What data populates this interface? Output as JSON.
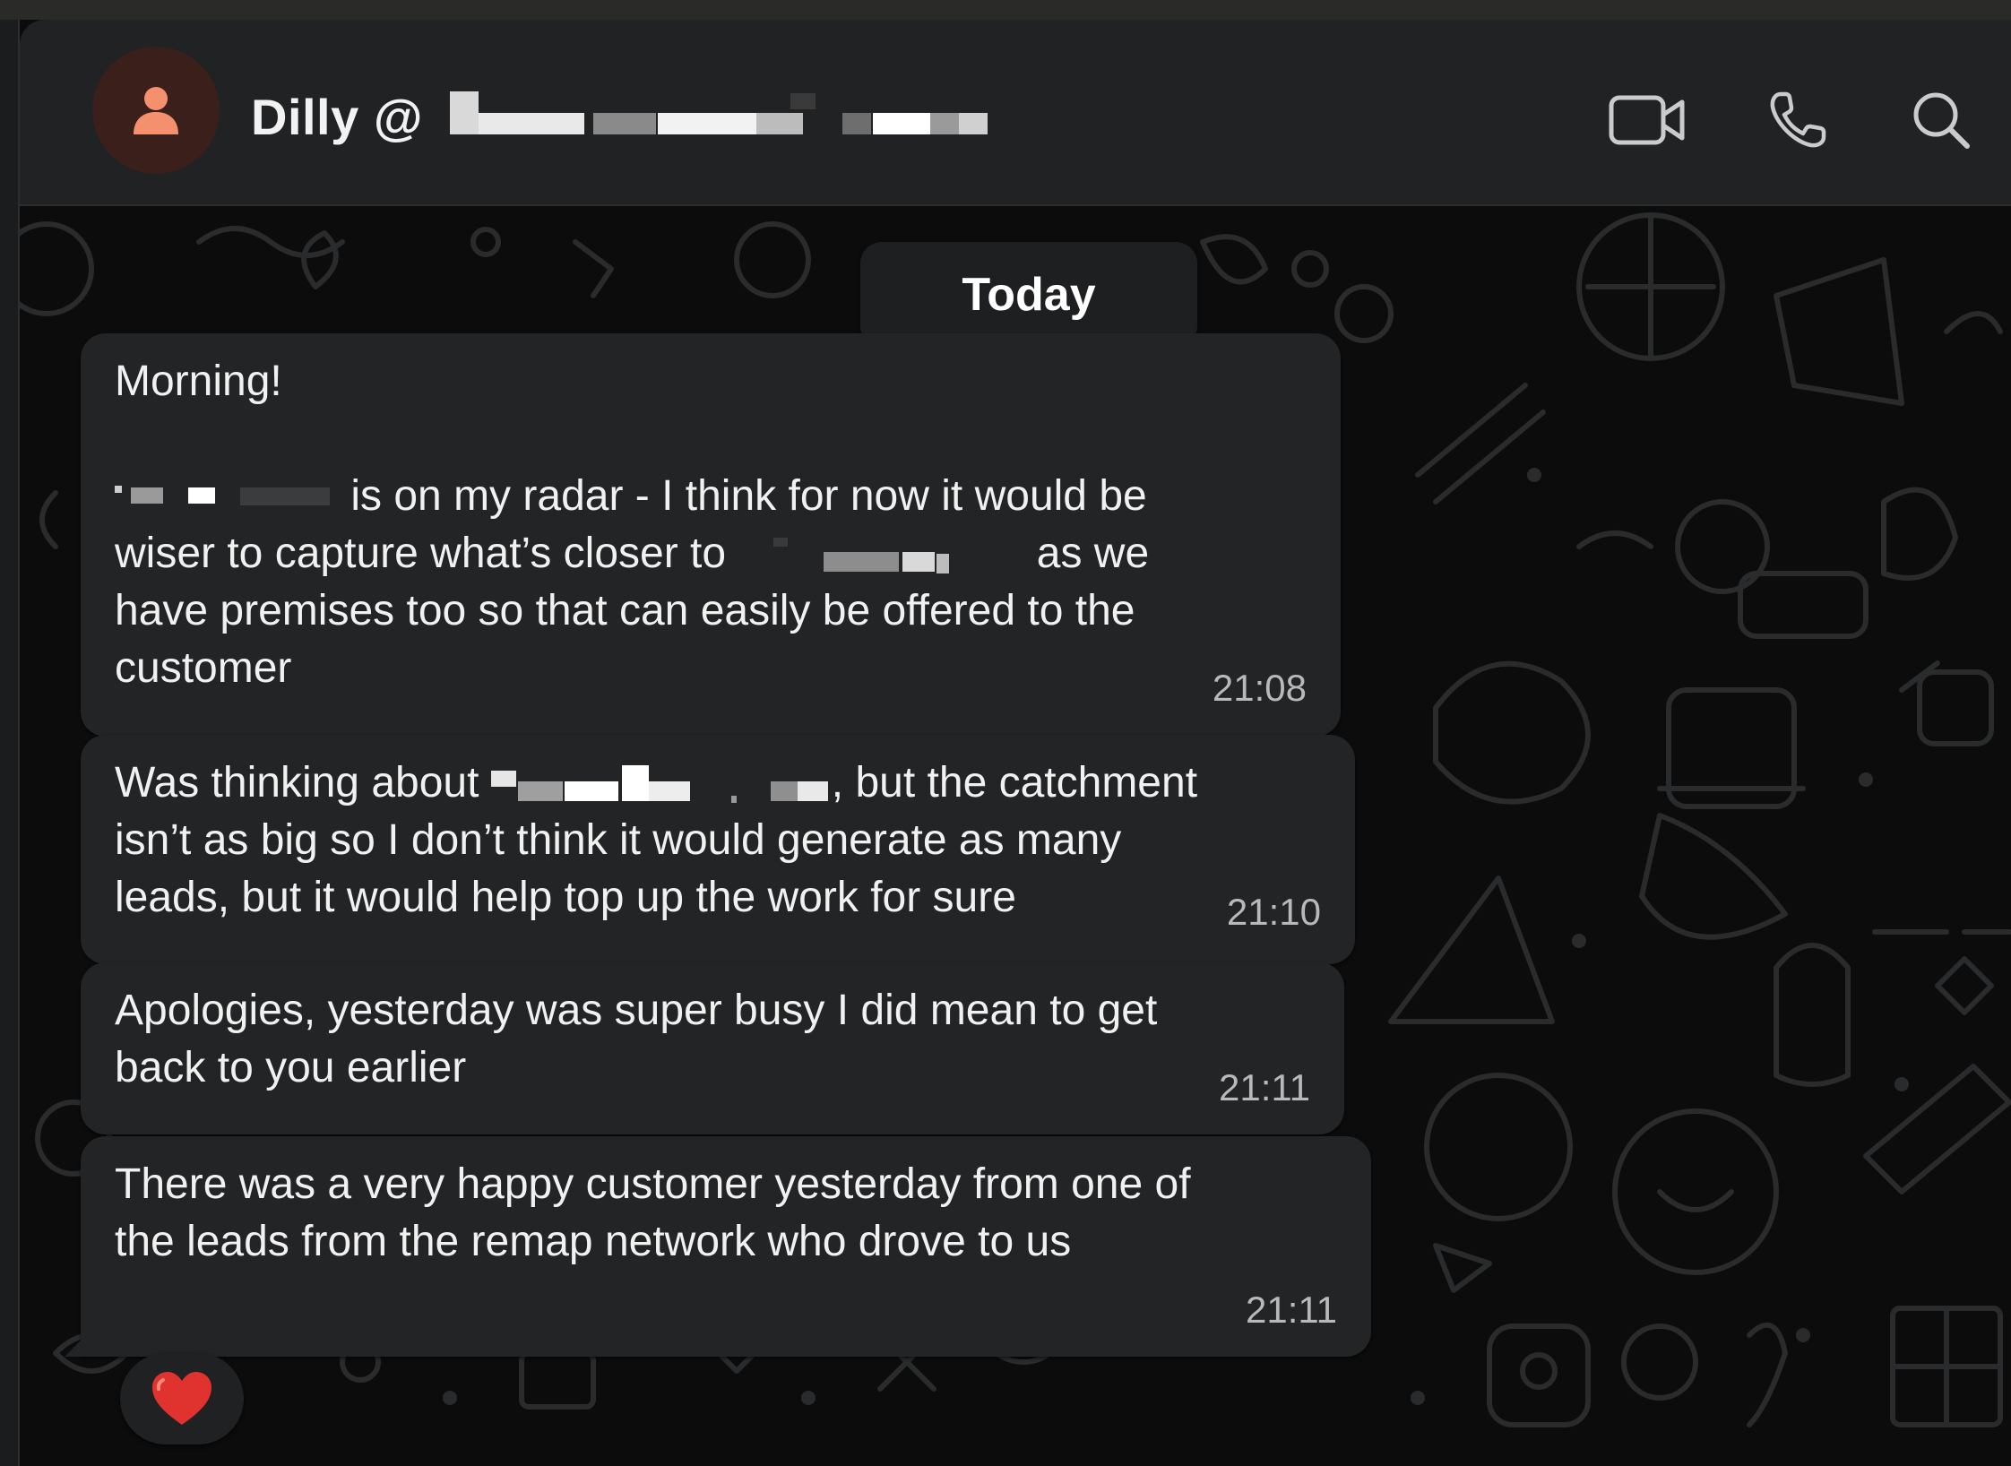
{
  "header": {
    "contact_name": "Dilly @",
    "avatar_icon": "person-icon",
    "buttons": {
      "video": "video-call-icon",
      "voice": "voice-call-icon",
      "search": "search-icon"
    }
  },
  "chat": {
    "date_label": "Today",
    "messages": [
      {
        "line1": "Morning!",
        "line2_after_redaction": "is on my radar - I think for now it would be",
        "line3_start": "wiser to capture what’s closer to",
        "line3_end": "as we",
        "line4": "have premises too so that can easily be offered to the",
        "line5": "customer",
        "time": "21:08"
      },
      {
        "line1_start": "Was thinking about",
        "line1_end": ", but the catchment",
        "line2": "isn’t as big so I don’t think it would generate as many",
        "line3": "leads, but it would help top up the work for sure",
        "time": "21:10"
      },
      {
        "text": "Apologies, yesterday was super busy I did mean to get\nback to you earlier",
        "time": "21:11"
      },
      {
        "text": "There was a very happy customer yesterday from one of\nthe leads from the remap network who drove to us",
        "time": "21:11"
      }
    ],
    "reaction": "❤️"
  },
  "colors": {
    "header_bg": "#202224",
    "bubble_bg": "#232426",
    "chat_bg": "#0c0c0c",
    "avatar_bg": "#3a1f1a",
    "avatar_accent": "#f5906e"
  }
}
